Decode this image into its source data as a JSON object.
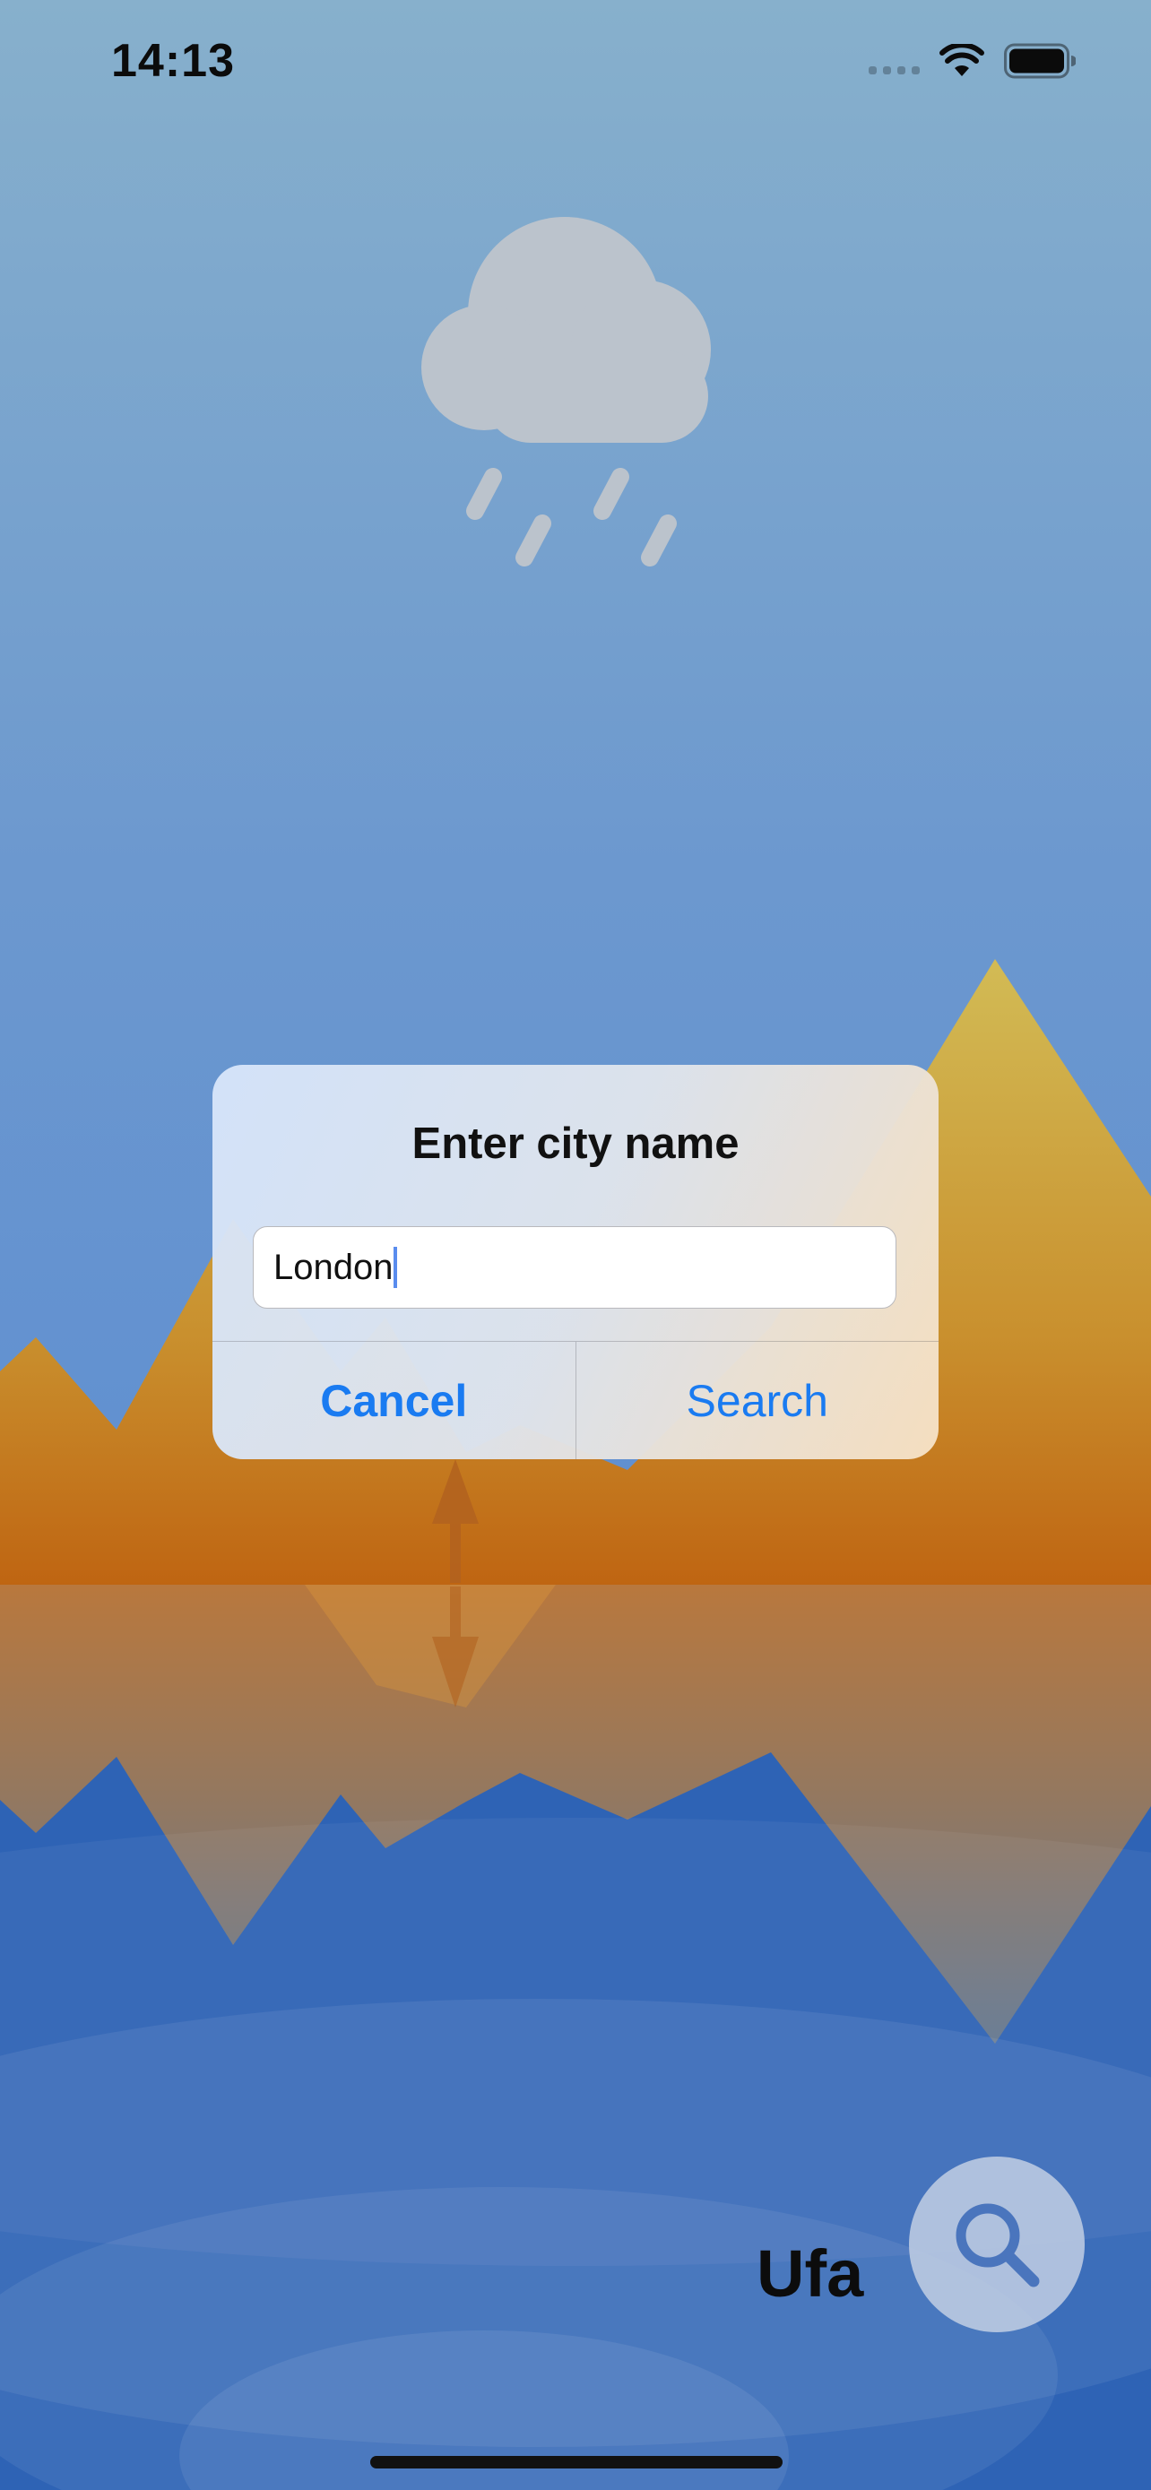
{
  "status_bar": {
    "time": "14:13",
    "icons": [
      "signal-icon",
      "wifi-icon",
      "battery-icon"
    ]
  },
  "weather": {
    "icon": "rain-cloud-icon"
  },
  "dialog": {
    "title": "Enter city name",
    "input_value": "London",
    "cancel_label": "Cancel",
    "search_label": "Search",
    "accent_color": "#1a7bf1"
  },
  "city": {
    "name": "Ufa"
  },
  "search_button": {
    "icon": "search-icon"
  },
  "colors": {
    "sky_top": "#87b0cc",
    "sky_bottom": "#5f8fd0",
    "mountain_top": "#d4b84e",
    "mountain_bottom": "#c06a12",
    "water": "#2e63b5"
  }
}
